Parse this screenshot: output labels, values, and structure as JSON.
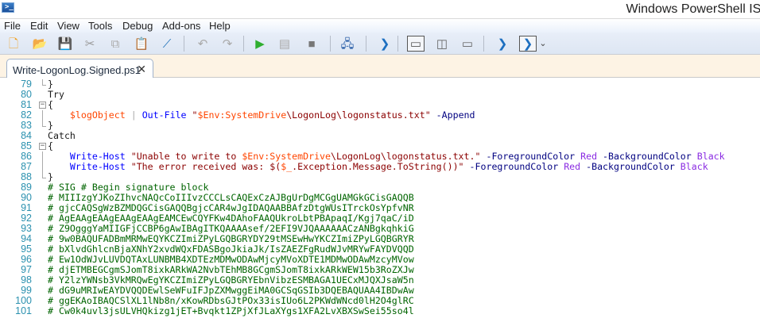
{
  "window": {
    "title": "Windows PowerShell ISE",
    "app_icon": "powershell-icon"
  },
  "menu": [
    "File",
    "Edit",
    "View",
    "Tools",
    "Debug",
    "Add-ons",
    "Help"
  ],
  "toolbar": [
    {
      "name": "new-icon",
      "glyph": "🗋",
      "color": "#f0a020"
    },
    {
      "name": "open-icon",
      "glyph": "📂",
      "color": "#d9a441"
    },
    {
      "name": "save-icon",
      "glyph": "💾",
      "color": "#2d5c9c"
    },
    {
      "name": "cut-icon",
      "glyph": "✂",
      "color": "#9a9a9a"
    },
    {
      "name": "copy-icon",
      "glyph": "⧉",
      "color": "#aaaaaa"
    },
    {
      "name": "paste-icon",
      "glyph": "📋",
      "color": "#333333"
    },
    {
      "name": "clear-console-icon",
      "glyph": "⟋",
      "color": "#1c6fb8"
    },
    {
      "name": "undo-icon",
      "glyph": "↶",
      "color": "#aaaaaa"
    },
    {
      "name": "redo-icon",
      "glyph": "↷",
      "color": "#aaaaaa"
    },
    {
      "name": "run-script-icon",
      "glyph": "▶",
      "color": "#2fae2f"
    },
    {
      "name": "run-selection-icon",
      "glyph": "▤",
      "color": "#aaaaaa"
    },
    {
      "name": "stop-icon",
      "glyph": "■",
      "color": "#777777"
    },
    {
      "name": "remote-powershell-icon",
      "glyph": "🖧",
      "color": "#2b5fa8"
    },
    {
      "name": "start-powershell-icon",
      "glyph": "❯",
      "color": "#1d6fc0"
    },
    {
      "name": "show-script-top-icon",
      "glyph": "▭",
      "color": "#555555"
    },
    {
      "name": "show-script-right-icon",
      "glyph": "◫",
      "color": "#666666"
    },
    {
      "name": "show-script-maximized-icon",
      "glyph": "▭",
      "color": "#666666"
    },
    {
      "name": "show-commands-icon",
      "glyph": "❯",
      "color": "#1d6fc0"
    },
    {
      "name": "show-command-addon-icon",
      "glyph": "❯",
      "color": "#1d6fc0"
    },
    {
      "name": "toolbar-overflow-icon",
      "glyph": "⌄",
      "color": "#444444"
    }
  ],
  "tab": {
    "label": "Write-LogonLog.Signed.ps1",
    "close": "✕"
  },
  "colors": {
    "keyword": "#1a1a1a",
    "variable": "#ff4500",
    "cmdlet": "#0000ff",
    "string": "#8b0000",
    "param": "#000080",
    "member": "#1a1a1a",
    "enum": "#8a2be2",
    "comment": "#006400",
    "op": "#a9a9a9"
  },
  "code": [
    {
      "n": "79",
      "fold": "end",
      "t": [
        [
          "",
          "}"
        ]
      ]
    },
    {
      "n": "80",
      "t": [
        [
          "keyword",
          "Try"
        ]
      ]
    },
    {
      "n": "81",
      "fold": "open",
      "t": [
        [
          "",
          "{"
        ]
      ]
    },
    {
      "n": "82",
      "fold": "mid",
      "t": [
        [
          "",
          "    "
        ],
        [
          "variable",
          "$logObject"
        ],
        [
          "op",
          " | "
        ],
        [
          "cmdlet",
          "Out-File"
        ],
        [
          "string",
          " \""
        ],
        [
          "variable",
          "$Env:SystemDrive"
        ],
        [
          "string",
          "\\LogonLog\\logonstatus.txt\""
        ],
        [
          "param",
          " -Append"
        ]
      ]
    },
    {
      "n": "83",
      "fold": "end",
      "t": [
        [
          "",
          "}"
        ]
      ]
    },
    {
      "n": "84",
      "t": [
        [
          "keyword",
          "Catch"
        ]
      ]
    },
    {
      "n": "85",
      "fold": "open",
      "t": [
        [
          "",
          "{"
        ]
      ]
    },
    {
      "n": "86",
      "fold": "mid",
      "t": [
        [
          "",
          "    "
        ],
        [
          "cmdlet",
          "Write-Host"
        ],
        [
          "string",
          " \"Unable to write to "
        ],
        [
          "variable",
          "$Env:SystemDrive"
        ],
        [
          "string",
          "\\LogonLog\\logonstatus.txt.\""
        ],
        [
          "param",
          " -ForegroundColor"
        ],
        [
          "enum",
          " Red"
        ],
        [
          "param",
          " -BackgroundColor"
        ],
        [
          "enum",
          " Black"
        ]
      ]
    },
    {
      "n": "87",
      "fold": "mid",
      "t": [
        [
          "",
          "    "
        ],
        [
          "cmdlet",
          "Write-Host"
        ],
        [
          "string",
          " \"The error received was: $("
        ],
        [
          "variable",
          "$_"
        ],
        [
          "string",
          ".Exception.Message.ToString())\""
        ],
        [
          "param",
          " -ForegroundColor"
        ],
        [
          "enum",
          " Red"
        ],
        [
          "param",
          " -BackgroundColor"
        ],
        [
          "enum",
          " Black"
        ]
      ]
    },
    {
      "n": "88",
      "fold": "end",
      "t": [
        [
          "",
          "}"
        ]
      ]
    },
    {
      "n": "89",
      "t": [
        [
          "comment",
          "# SIG # Begin signature block"
        ]
      ]
    },
    {
      "n": "90",
      "t": [
        [
          "comment",
          "# MIIIzgYJKoZIhvcNAQcCoIIIvzCCCLsCAQExCzAJBgUrDgMCGgUAMGkGCisGAQQB"
        ]
      ]
    },
    {
      "n": "91",
      "t": [
        [
          "comment",
          "# gjcCAQSgWzBZMDQGCisGAQQBgjcCAR4wJgIDAQAABBAfzDtgWUsITrckOsYpfvNR"
        ]
      ]
    },
    {
      "n": "92",
      "t": [
        [
          "comment",
          "# AgEAAgEAAgEAAgEAAgEAMCEwCQYFKw4DAhoFAAQUkroLbtPBApaqI/Kgj7qaC/iD"
        ]
      ]
    },
    {
      "n": "93",
      "t": [
        [
          "comment",
          "# Z9OgggYaMIIGFjCCBP6gAwIBAgITKQAAAAsef/2EFI9VJQAAAAAACzANBgkqhkiG"
        ]
      ]
    },
    {
      "n": "94",
      "t": [
        [
          "comment",
          "# 9w0BAQUFADBmMRMwEQYKCZImiZPyLGQBGRYDY29tMSEwHwYKCZImiZPyLGQBGRYR"
        ]
      ]
    },
    {
      "n": "95",
      "t": [
        [
          "comment",
          "# bXlvdGhlcnBjaXNhY2xvdWQxFDASBgoJkiaJk/IsZAEZFgRudWJvMRYwFAYDVQQD"
        ]
      ]
    },
    {
      "n": "96",
      "t": [
        [
          "comment",
          "# Ew1OdWJvLUVDQTAxLUNBMB4XDTEzMDMwODAwMjcyMVoXDTE1MDMwODAwMzcyMVow"
        ]
      ]
    },
    {
      "n": "97",
      "t": [
        [
          "comment",
          "# djETMBEGCgmSJomT8ixkARkWA2NvbTEhMB8GCgmSJomT8ixkARkWEW15b3RoZXJw"
        ]
      ]
    },
    {
      "n": "98",
      "t": [
        [
          "comment",
          "# Y2lzYWNsb3VkMRQwEgYKCZImiZPyLGQBGRYEbnVibzESMBAGA1UECxMJQXJsaW5n"
        ]
      ]
    },
    {
      "n": "99",
      "t": [
        [
          "comment",
          "# dG9uMRIwEAYDVQQDEwlSeWFuIFJpZXMwggEiMA0GCSqGSIb3DQEBAQUAA4IBDwAw"
        ]
      ]
    },
    {
      "n": "100",
      "t": [
        [
          "comment",
          "# ggEKAoIBAQCSlXL1lNb8n/xKowRDbsGJtPOx33isIUo6L2PKWdWNcd0lH2O4glRC"
        ]
      ]
    },
    {
      "n": "101",
      "t": [
        [
          "comment",
          "# Cw0k4uvl3jsULVHQkizg1jET+Bvqkt1ZPjXfJLaXYgs1XFA2LvXBXSwSei55so4l"
        ]
      ]
    }
  ]
}
